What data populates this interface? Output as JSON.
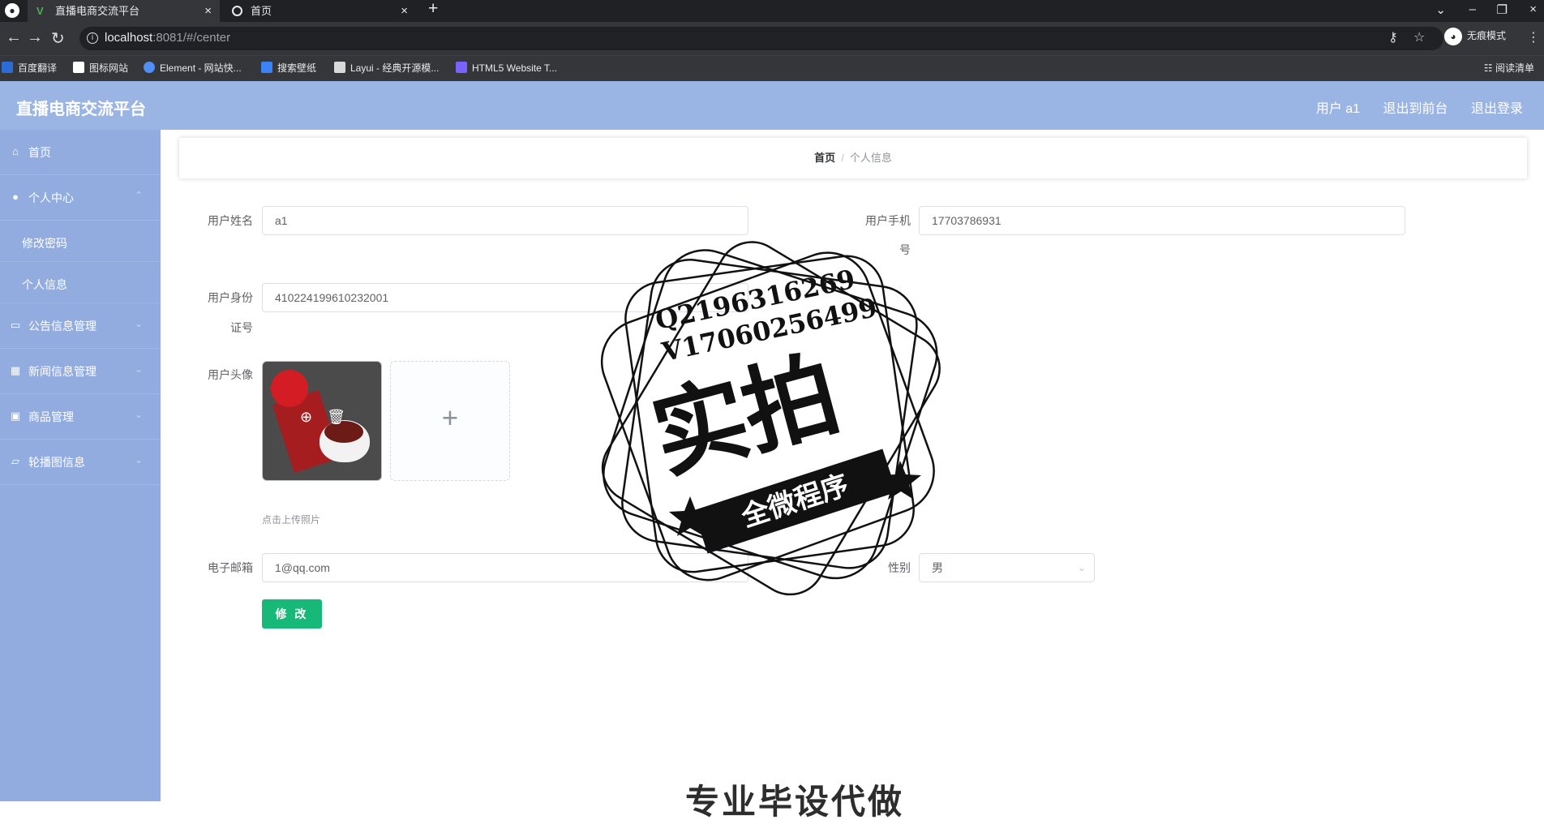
{
  "browser": {
    "tabs": [
      {
        "label": "直播电商交流平台",
        "active": true
      },
      {
        "label": "首页",
        "active": false
      }
    ],
    "url_host": "localhost",
    "url_port_path": ":8081/#/center",
    "profile_label": "无痕模式",
    "bookmarks": [
      "百度翻译",
      "图标网站",
      "Element - 网站快...",
      "搜索壁纸",
      "Layui - 经典开源模...",
      "HTML5 Website T..."
    ],
    "reading_list": "阅读清单"
  },
  "app": {
    "title": "直播电商交流平台",
    "header_links": [
      "用户 a1",
      "退出到前台",
      "退出登录"
    ]
  },
  "sidebar": {
    "items": [
      {
        "label": "首页",
        "icon": "home-icon"
      },
      {
        "label": "个人中心",
        "icon": "user-icon"
      },
      {
        "label": "修改密码",
        "icon": ""
      },
      {
        "label": "个人信息",
        "icon": ""
      },
      {
        "label": "公告信息管理",
        "icon": "notice-icon"
      },
      {
        "label": "新闻信息管理",
        "icon": "grid-icon"
      },
      {
        "label": "商品管理",
        "icon": "box-icon"
      },
      {
        "label": "轮播图信息",
        "icon": "message-icon"
      }
    ]
  },
  "breadcrumb": {
    "home": "首页",
    "current": "个人信息"
  },
  "form": {
    "username_label": "用户姓名",
    "username_value": "a1",
    "phone_label_line1": "用户手机",
    "phone_label_line2": "号",
    "phone_value": "17703786931",
    "idcard_label_line1": "用户身份",
    "idcard_label_line2": "证号",
    "idcard_value": "410224199610232001",
    "avatar_label": "用户头像",
    "upload_hint": "点击上传照片",
    "email_label": "电子邮箱",
    "email_value": "1@qq.com",
    "gender_label": "性别",
    "gender_value": "男",
    "submit_label": "修 改"
  },
  "watermark": {
    "line1": "Q2196316269",
    "line2": "V17060256499",
    "big": "实拍",
    "ribbon": "全微程序"
  },
  "bottom_partial_text": "专业毕设代做"
}
